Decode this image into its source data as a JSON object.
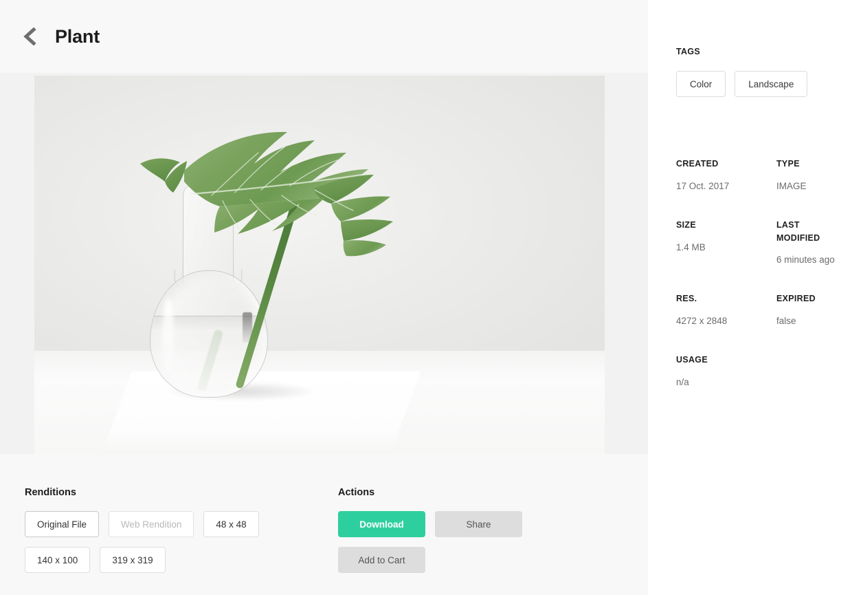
{
  "header": {
    "back_icon": "chevron-left-icon",
    "title": "Plant"
  },
  "preview": {
    "alt": "Green monstera leaf in a clear glass carafe of water on a white surface"
  },
  "renditions": {
    "heading": "Renditions",
    "items": [
      {
        "label": "Original File",
        "state": "default"
      },
      {
        "label": "Web Rendition",
        "state": "disabled"
      },
      {
        "label": "48 x 48",
        "state": "default"
      },
      {
        "label": "140 x 100",
        "state": "default"
      },
      {
        "label": "319 x 319",
        "state": "default"
      }
    ]
  },
  "actions": {
    "heading": "Actions",
    "download_label": "Download",
    "share_label": "Share",
    "cart_label": "Add to Cart",
    "primary_color": "#2ecf9e",
    "muted_color": "#dddddd"
  },
  "sidebar": {
    "tags_label": "TAGS",
    "tags": [
      {
        "label": "Color"
      },
      {
        "label": "Landscape"
      }
    ],
    "metadata": [
      {
        "key": "CREATED",
        "value": "17 Oct. 2017"
      },
      {
        "key": "TYPE",
        "value": "IMAGE"
      },
      {
        "key": "SIZE",
        "value": "1.4 MB"
      },
      {
        "key": "LAST MODIFIED",
        "value": "6 minutes ago"
      },
      {
        "key": "RES.",
        "value": "4272 x 2848"
      },
      {
        "key": "EXPIRED",
        "value": "false"
      },
      {
        "key": "USAGE",
        "value": "n/a"
      }
    ]
  }
}
